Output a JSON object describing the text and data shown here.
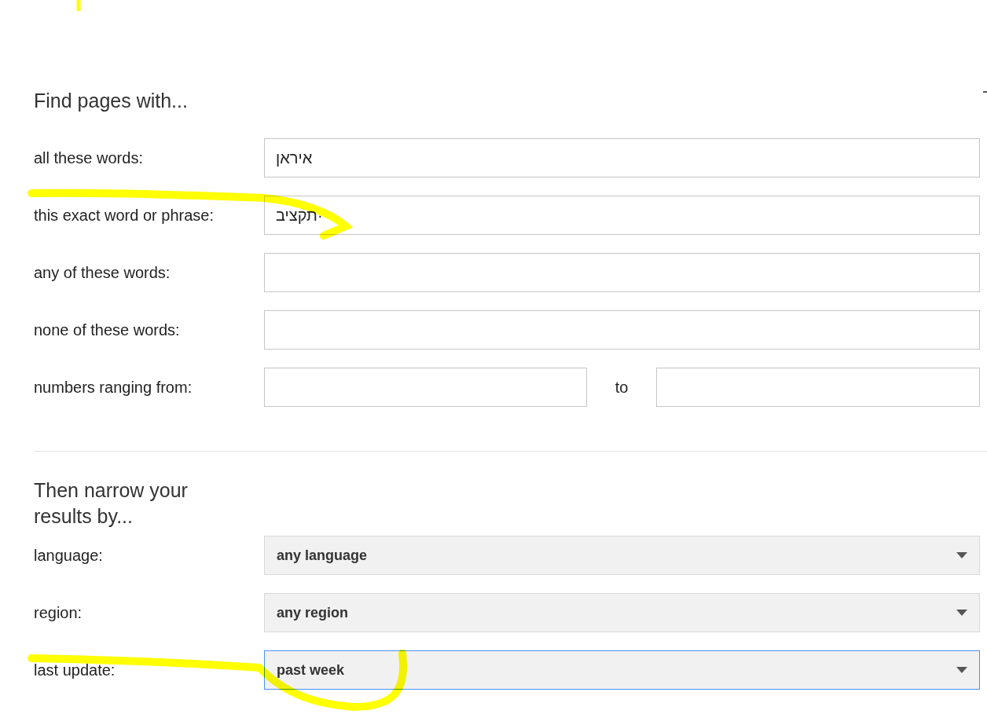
{
  "find_section": {
    "heading": "Find pages with...",
    "rows": [
      {
        "kind": "text",
        "label": "all these words:",
        "value": "איראן"
      },
      {
        "kind": "text",
        "label": "this exact word or phrase:",
        "value": "תקציב·"
      },
      {
        "kind": "text",
        "label": "any of these words:",
        "value": ""
      },
      {
        "kind": "text",
        "label": "none of these words:",
        "value": ""
      },
      {
        "kind": "range",
        "label": "numbers ranging from:",
        "separator": "to",
        "from_value": "",
        "to_value": ""
      }
    ]
  },
  "narrow_section": {
    "heading": "Then narrow your results by...",
    "rows": [
      {
        "label": "language:",
        "value": "any language",
        "focused": false
      },
      {
        "label": "region:",
        "value": "any region",
        "focused": false
      },
      {
        "label": "last update:",
        "value": "past week",
        "focused": true
      }
    ]
  }
}
